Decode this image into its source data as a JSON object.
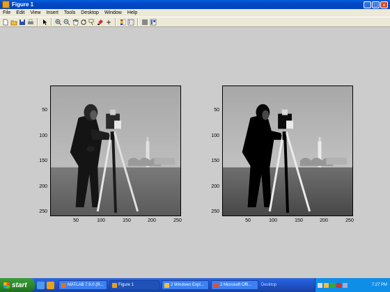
{
  "window": {
    "title": "Figure 1",
    "minimize": "_",
    "maximize": "□",
    "close": "×"
  },
  "menu": [
    "File",
    "Edit",
    "View",
    "Insert",
    "Tools",
    "Desktop",
    "Window",
    "Help"
  ],
  "toolbar": [
    "new-icon",
    "open-icon",
    "save-icon",
    "print-icon",
    "arrow-icon",
    "zoom-in-icon",
    "zoom-out-icon",
    "pan-icon",
    "rotate-icon",
    "data-cursor-icon",
    "brush-icon",
    "link-icon",
    "colorbar-icon",
    "legend-icon",
    "plot-tools-hide-icon",
    "plot-tools-show-icon"
  ],
  "axes": [
    {
      "name": "original-image",
      "yticks": [
        "50",
        "100",
        "150",
        "200",
        "250"
      ],
      "xticks": [
        "50",
        "100",
        "150",
        "200",
        "250"
      ]
    },
    {
      "name": "processed-image",
      "yticks": [
        "50",
        "100",
        "150",
        "200",
        "250"
      ],
      "xticks": [
        "50",
        "100",
        "150",
        "200",
        "250"
      ]
    }
  ],
  "taskbar": {
    "start": "start",
    "tasks": [
      {
        "label": "MATLAB 7.9.0 (R...",
        "icon": "matlab-icon",
        "active": false
      },
      {
        "label": "Figure 1",
        "icon": "figure-icon",
        "active": true
      },
      {
        "label": "2 Windows Expl...",
        "icon": "folder-icon",
        "active": false
      },
      {
        "label": "2 Microsoft Offi...",
        "icon": "office-icon",
        "active": false
      }
    ],
    "desktop": "Desktop",
    "clock": "7:27 PM"
  }
}
